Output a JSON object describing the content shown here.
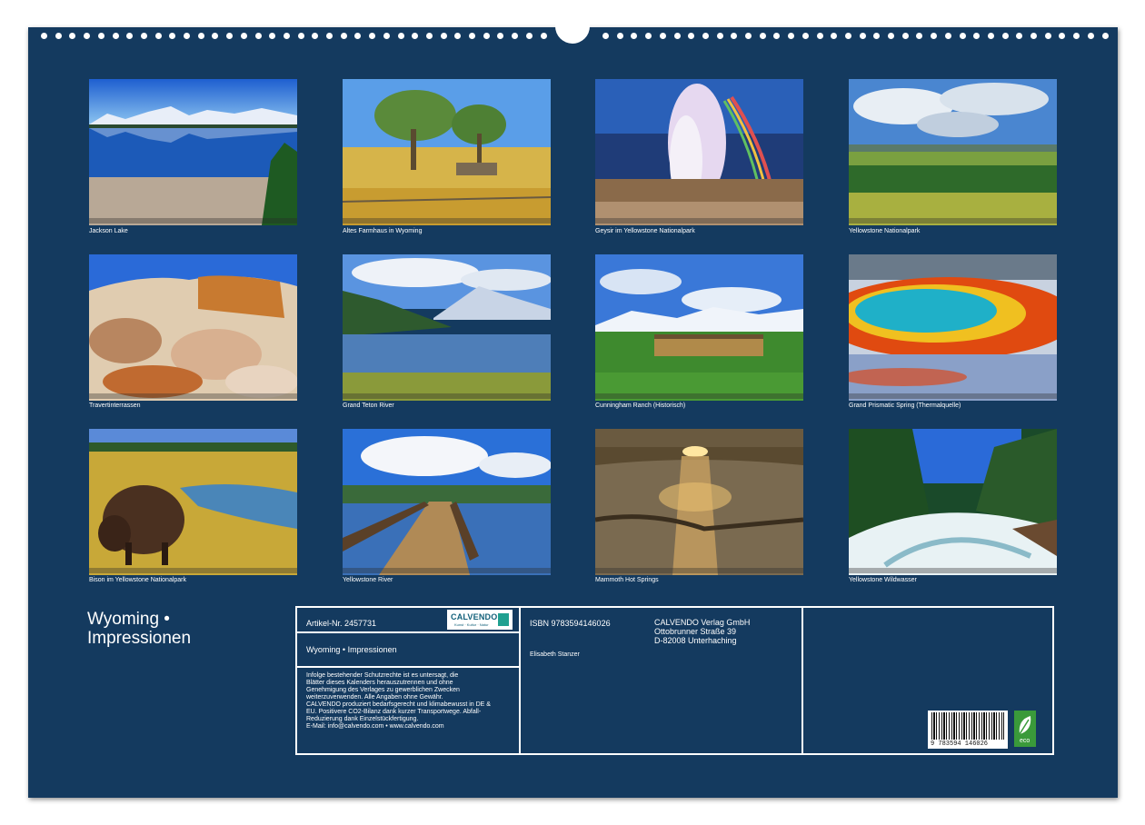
{
  "calendar_title": [
    "Wyoming •",
    "Impressionen"
  ],
  "photos": [
    {
      "caption": "Jackson Lake",
      "icon": "lake-mountains-photo"
    },
    {
      "caption": "Altes Farmhaus in Wyoming",
      "icon": "farmhouse-trees-photo"
    },
    {
      "caption": "Geysir im Yellowstone Nationalpark",
      "icon": "geyser-rainbow-photo"
    },
    {
      "caption": "Yellowstone Nationalpark",
      "icon": "valley-clouds-photo"
    },
    {
      "caption": "Travertinterrassen",
      "icon": "travertine-terraces-photo"
    },
    {
      "caption": "Grand Teton River",
      "icon": "river-mountains-photo"
    },
    {
      "caption": "Cunningham Ranch (Historisch)",
      "icon": "log-cabin-photo"
    },
    {
      "caption": "Grand Prismatic Spring (Thermalquelle)",
      "icon": "hot-spring-photo"
    },
    {
      "caption": "Bison im Yellowstone Nationalpark",
      "icon": "bison-photo"
    },
    {
      "caption": "Yellowstone River",
      "icon": "boardwalk-photo"
    },
    {
      "caption": "Mammoth Hot Springs",
      "icon": "sunset-springs-photo"
    },
    {
      "caption": "Yellowstone Wildwasser",
      "icon": "whitewater-photo"
    }
  ],
  "info": {
    "article": "Artikel-Nr. 2457731",
    "publisher_logo": "CALVENDO",
    "publisher_logo_sub": "Kunst · Kultur · Natur",
    "product_title": "Wyoming • Impressionen",
    "legal": [
      "Infolge bestehender Schutzrechte ist es untersagt, die",
      "Blätter dieses Kalenders herauszutrennen und ohne",
      "Genehmigung des Verlages zu gewerblichen Zwecken",
      "weiterzuverwenden. Alle Angaben ohne Gewähr.",
      "CALVENDO produziert bedarfsgerecht und klimabewusst in DE &",
      "EU. Positivere CO2-Bilanz dank kurzer Transportwege. Abfall-",
      "Reduzierung dank Einzelstückfertigung.",
      "E-Mail: info@calvendo.com • www.calvendo.com"
    ],
    "isbn": "ISBN 9783594146026",
    "author": "Elisabeth Stanzer",
    "address": [
      "CALVENDO Verlag GmbH",
      "Ottobrunner Straße 39",
      "D-82008 Unterhaching"
    ],
    "barcode_digits": "9 783594 146026",
    "eco_label": "eco"
  }
}
